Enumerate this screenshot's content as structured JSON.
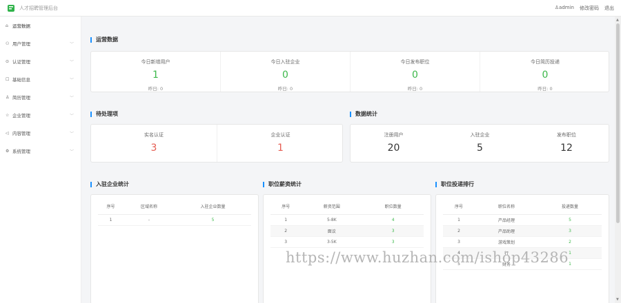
{
  "header": {
    "app_title": "人才招聘管理后台",
    "user": "♙admin",
    "change_password": "修改密码",
    "logout": "退出"
  },
  "sidebar": {
    "items": [
      {
        "label": "运营数据",
        "icon": "home-icon",
        "glyph": "⌂"
      },
      {
        "label": "用户管理",
        "icon": "users-icon",
        "glyph": "⚇"
      },
      {
        "label": "认证管理",
        "icon": "verify-icon",
        "glyph": "⊙"
      },
      {
        "label": "基础信息",
        "icon": "info-icon",
        "glyph": "☐"
      },
      {
        "label": "简历管理",
        "icon": "resume-icon",
        "glyph": "♙"
      },
      {
        "label": "企业管理",
        "icon": "star-icon",
        "glyph": "☆"
      },
      {
        "label": "内容管理",
        "icon": "send-icon",
        "glyph": "◁"
      },
      {
        "label": "系统管理",
        "icon": "gear-icon",
        "glyph": "⚙"
      }
    ]
  },
  "ops": {
    "title": "运营数据",
    "stats": [
      {
        "label": "今日新增用户",
        "value": "1",
        "yesterday": "昨日: 0"
      },
      {
        "label": "今日入驻企业",
        "value": "0",
        "yesterday": "昨日: 0"
      },
      {
        "label": "今日发布职位",
        "value": "0",
        "yesterday": "昨日: 0"
      },
      {
        "label": "今日简历投递",
        "value": "0",
        "yesterday": "昨日: 0"
      }
    ]
  },
  "pending": {
    "title": "待处理项",
    "items": [
      {
        "label": "实名认证",
        "value": "3"
      },
      {
        "label": "企业认证",
        "value": "1"
      }
    ]
  },
  "data_stats": {
    "title": "数据统计",
    "items": [
      {
        "label": "注册用户",
        "value": "20"
      },
      {
        "label": "入驻企业",
        "value": "5"
      },
      {
        "label": "发布职位",
        "value": "12"
      }
    ]
  },
  "enterprise_table": {
    "title": "入驻企业统计",
    "headers": [
      "序号",
      "区域名称",
      "入驻企业数量"
    ],
    "rows": [
      [
        "1",
        "-",
        "5"
      ]
    ]
  },
  "salary_table": {
    "title": "职位薪资统计",
    "headers": [
      "序号",
      "薪资范围",
      "职位数量"
    ],
    "rows": [
      [
        "1",
        "5-8K",
        "4"
      ],
      [
        "2",
        "面议",
        "3"
      ],
      [
        "3",
        "3-5K",
        "3"
      ]
    ]
  },
  "ranking_table": {
    "title": "职位投递排行",
    "headers": [
      "序号",
      "职位名称",
      "投递数量"
    ],
    "rows": [
      [
        "1",
        "产品经理",
        "5"
      ],
      [
        "2",
        "产品助理",
        "3"
      ],
      [
        "3",
        "游戏策划",
        "2"
      ],
      [
        "4",
        "行",
        "1"
      ],
      [
        "5",
        "财务",
        "1"
      ]
    ]
  },
  "watermark": "https://www.huzhan.com/ishop43286",
  "colors": {
    "accent": "#1890ff",
    "positive": "#3cb84a",
    "alert": "#e55b50"
  }
}
